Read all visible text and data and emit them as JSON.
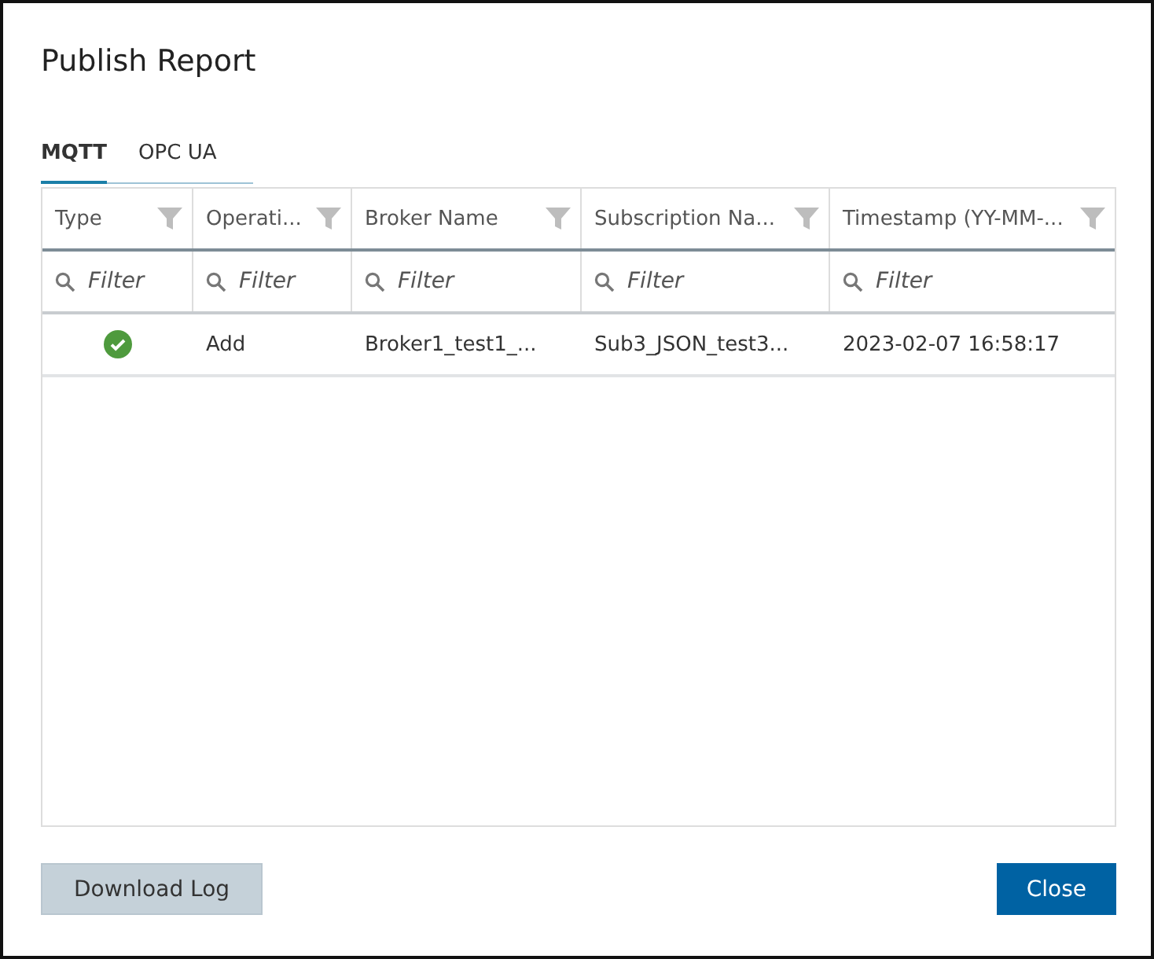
{
  "dialog": {
    "title": "Publish Report"
  },
  "tabs": [
    {
      "label": "MQTT",
      "selected": true
    },
    {
      "label": "OPC UA",
      "selected": false
    }
  ],
  "table": {
    "columns": [
      {
        "label": "Type"
      },
      {
        "label": "Operati..."
      },
      {
        "label": "Broker Name"
      },
      {
        "label": "Subscription Na..."
      },
      {
        "label": "Timestamp (YY-MM-..."
      }
    ],
    "filters": [
      {
        "placeholder": "Filter"
      },
      {
        "placeholder": "Filter"
      },
      {
        "placeholder": "Filter"
      },
      {
        "placeholder": "Filter"
      },
      {
        "placeholder": "Filter"
      }
    ],
    "rows": [
      {
        "kind": "success",
        "operation": "Add",
        "broker_name": "Broker1_test1_...",
        "subscription_name": "Sub3_JSON_test3...",
        "timestamp": "2023-02-07 16:58:17"
      }
    ]
  },
  "buttons": [
    {
      "kind": "secondary",
      "label": "Download Log"
    },
    {
      "kind": "primary",
      "label": "Close"
    }
  ]
}
